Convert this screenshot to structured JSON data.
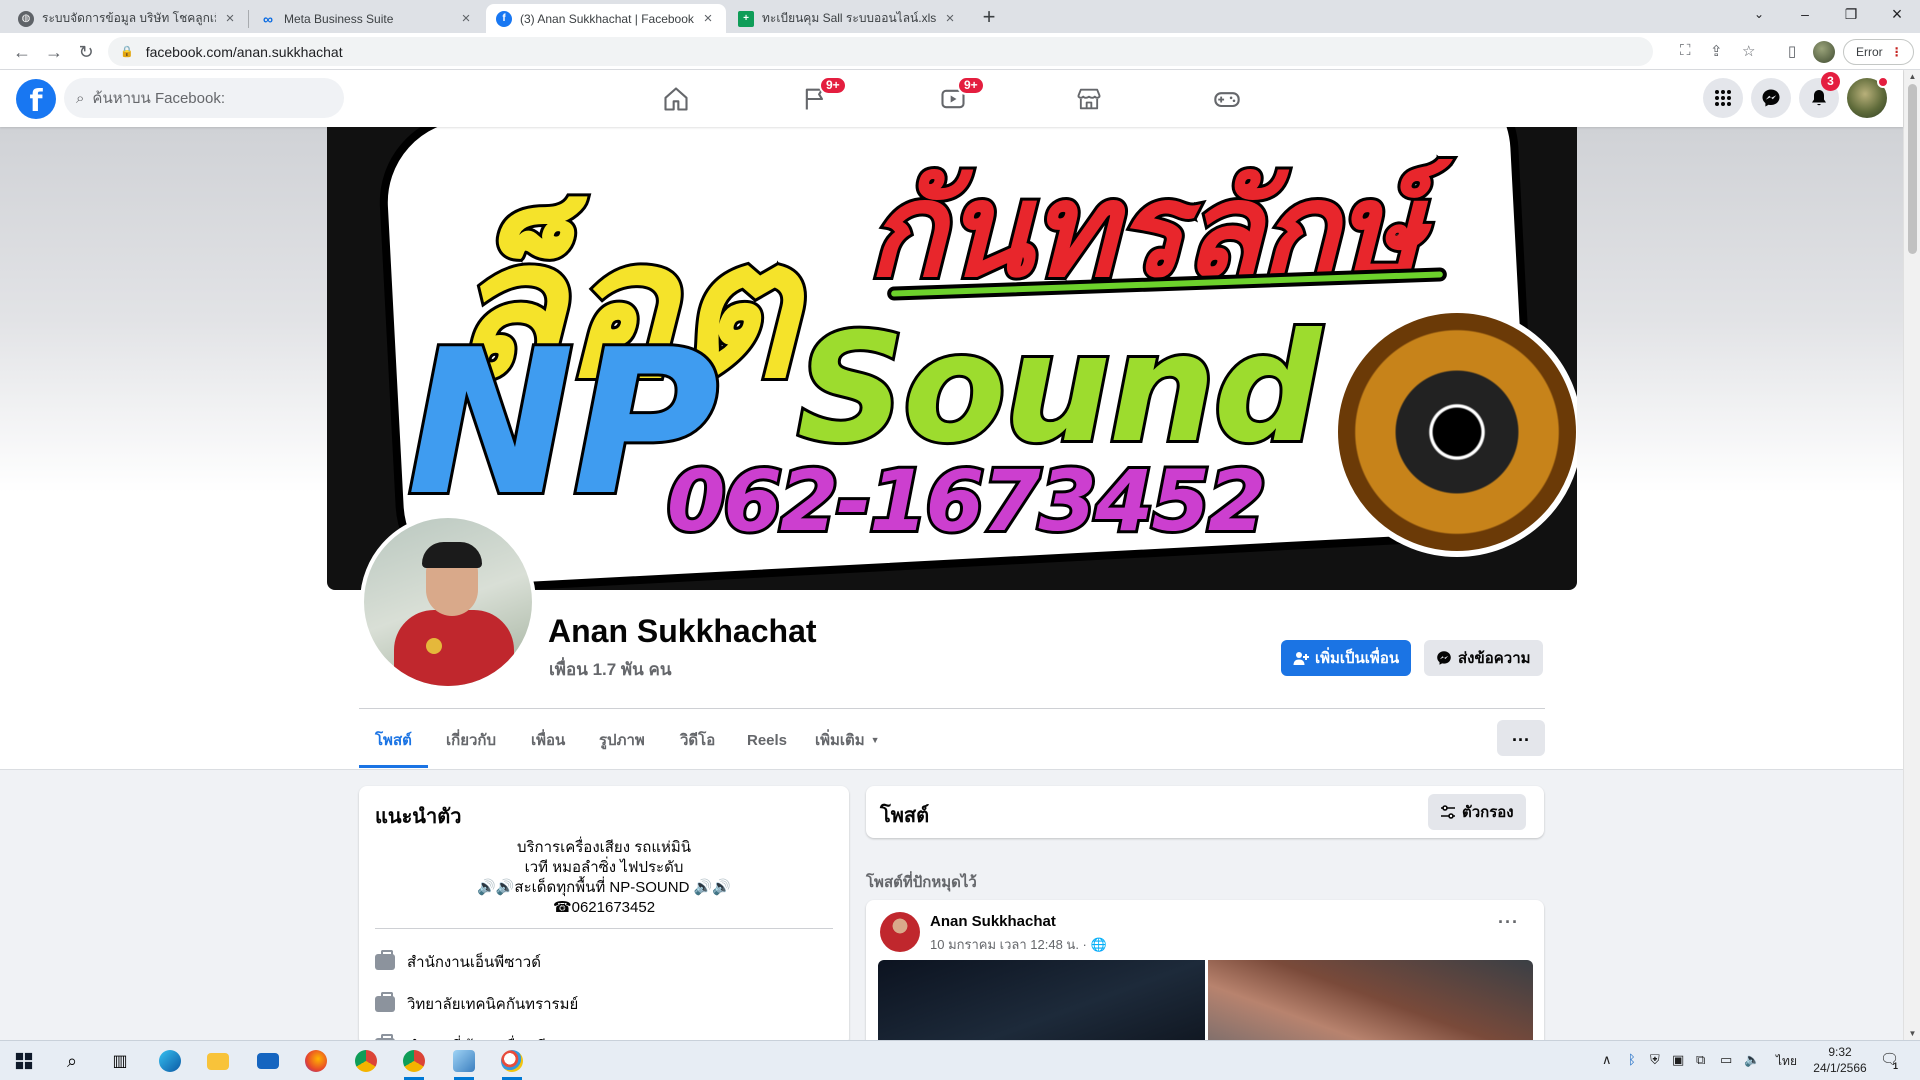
{
  "browser": {
    "tabs": [
      {
        "title": "ระบบจัดการข้อมูล บริษัท โชคลูกเม็ด",
        "icon": "globe-icon"
      },
      {
        "title": "Meta Business Suite",
        "icon": "meta-icon"
      },
      {
        "title": "(3) Anan Sukkhachat | Facebook",
        "icon": "facebook-icon"
      },
      {
        "title": "ทะเบียนคุม Sall ระบบออนไลน์.xlsx - G",
        "icon": "sheets-icon"
      }
    ],
    "url": "facebook.com/anan.sukkhachat",
    "error_label": "Error",
    "colors": {
      "tabbar": "#dee1e6",
      "omnibox": "#f1f3f4"
    }
  },
  "fb": {
    "search_placeholder": "ค้นหาบน Facebook:",
    "badges": {
      "groups": "9+",
      "watch": "9+",
      "notifications": "3"
    },
    "colors": {
      "brand": "#1877f2",
      "badge": "#e41e3f"
    }
  },
  "cover": {
    "line1": "ล็อต",
    "line2": "กันทรลักษ์",
    "line3": "NP",
    "line4": "Sound",
    "phone": "062-1673452"
  },
  "profile": {
    "name": "Anan Sukkhachat",
    "friends": "เพื่อน 1.7 พัน คน",
    "add_friend": "เพิ่มเป็นเพื่อน",
    "message": "ส่งข้อความ",
    "tabs": [
      "โพสต์",
      "เกี่ยวกับ",
      "เพื่อน",
      "รูปภาพ",
      "วิดีโอ",
      "Reels",
      "เพิ่มเติม"
    ],
    "more_dots": "..."
  },
  "intro": {
    "title": "แนะนำตัว",
    "bio": [
      "บริการเครื่องเสียง รถแห่มินิ",
      "เวที หมอลำซิ่ง ไฟประดับ",
      "🔊🔊สะเด็ดทุกพื้นที่ NP-SOUND 🔊🔊",
      "☎0621673452"
    ],
    "work": [
      "สำนักงานเอ็นพีซาวด์",
      "วิทยาลัยเทคนิคกันทรารมย์",
      "ทำงานที่ ร้านเครื่องเสียง"
    ]
  },
  "posts": {
    "title": "โพสต์",
    "filter": "ตัวกรอง",
    "pinned_label": "โพสต์ที่ปักหมุดไว้",
    "pinned_post": {
      "author": "Anan Sukkhachat",
      "date": "10 มกราคม เวลา 12:48 น. ·"
    }
  },
  "taskbar": {
    "lang": "ไทย",
    "time": "9:32",
    "date": "24/1/2566",
    "notification_count": "1"
  }
}
